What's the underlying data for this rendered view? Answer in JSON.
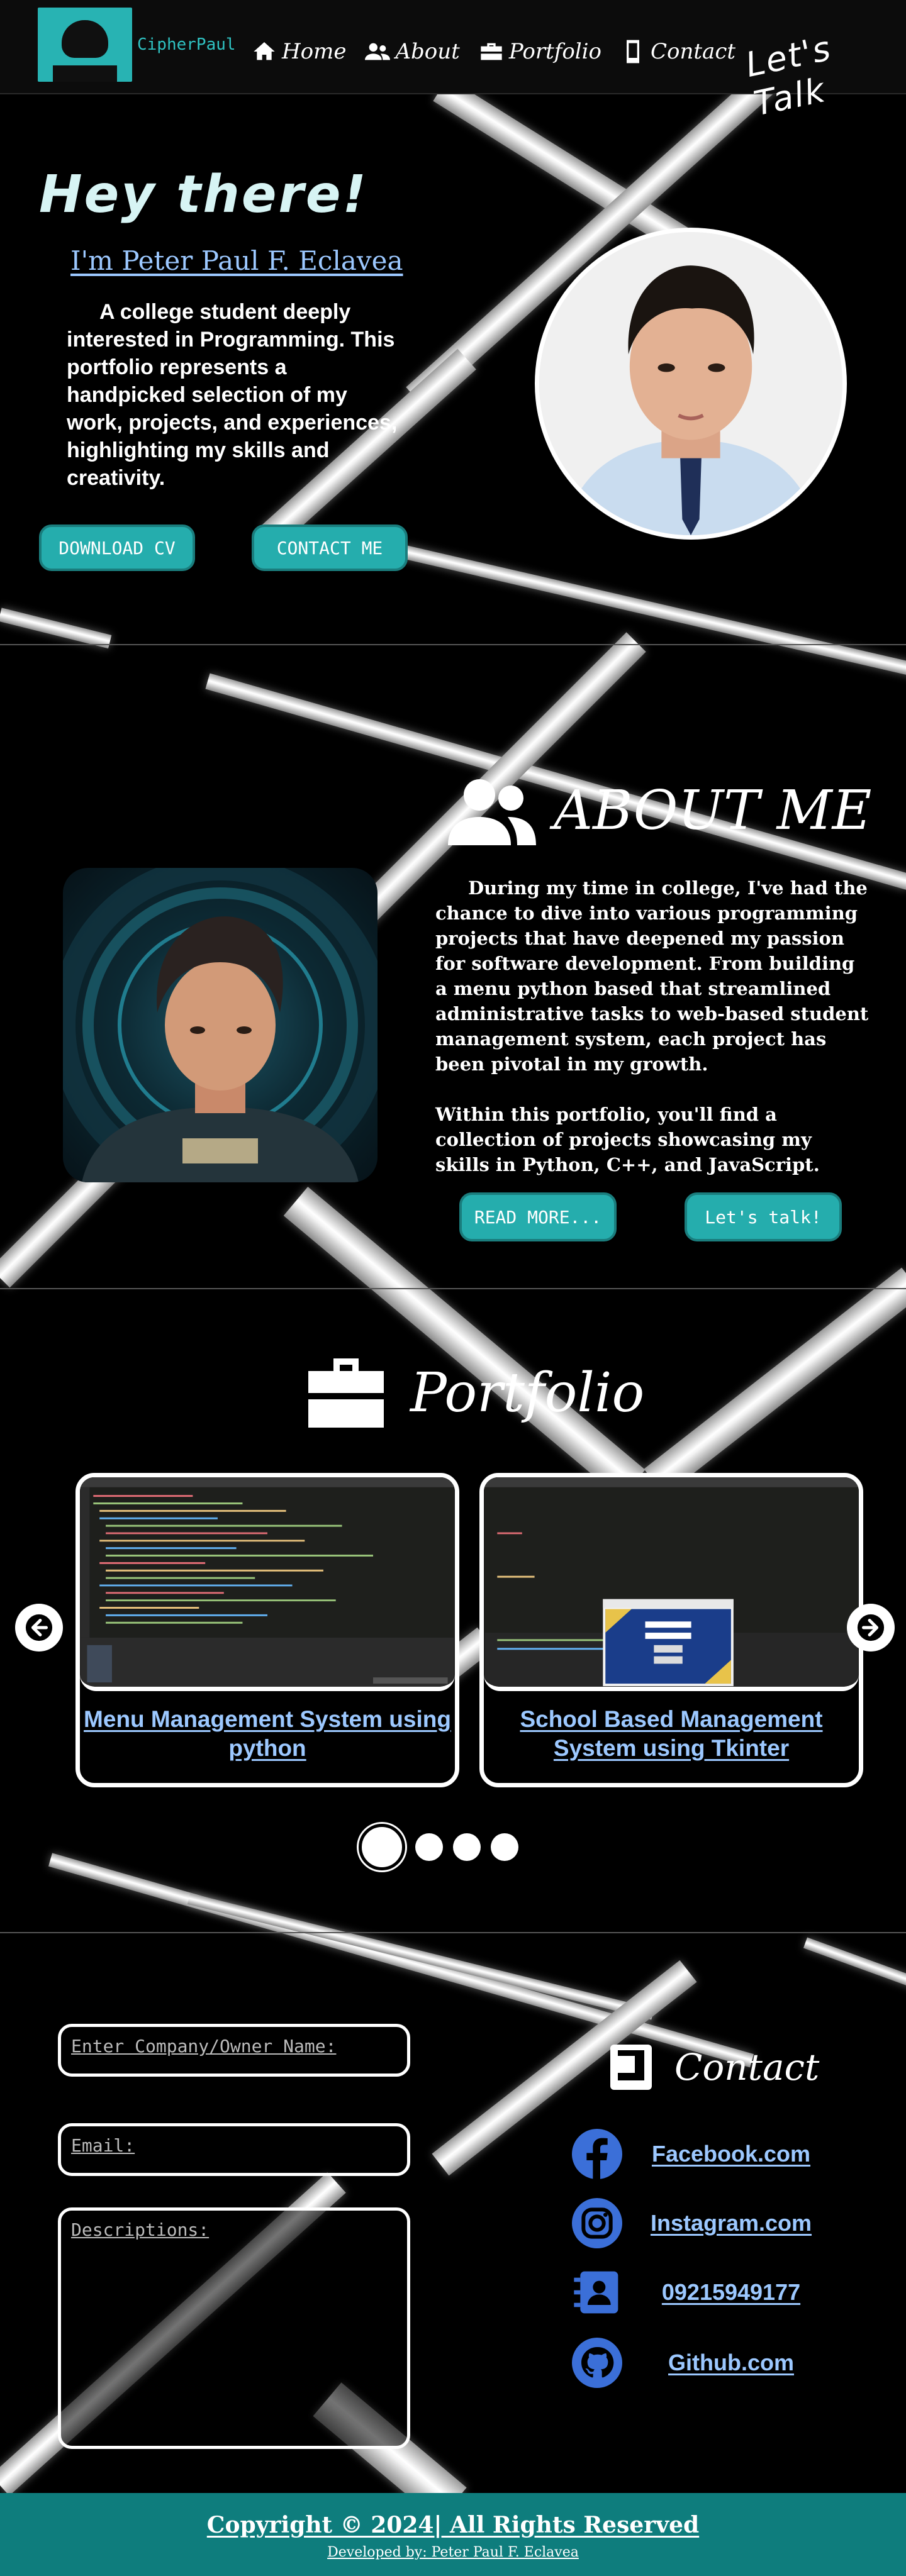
{
  "brand": {
    "name": "CipherPaul"
  },
  "nav": {
    "items": [
      {
        "label": "Home",
        "icon": "home-icon"
      },
      {
        "label": "About",
        "icon": "users-icon"
      },
      {
        "label": "Portfolio",
        "icon": "briefcase-icon"
      },
      {
        "label": "Contact",
        "icon": "phone-icon"
      }
    ],
    "cta": "Let's Talk"
  },
  "hero": {
    "greeting": "Hey there!",
    "name": "I'm Peter Paul F. Eclavea",
    "description": "A college student deeply interested in Programming. This portfolio represents a handpicked selection of my work, projects, and experiences, highlighting my skills and creativity.",
    "download_label": "DOWNLOAD CV",
    "contact_label": "CONTACT ME"
  },
  "about": {
    "title": "ABOUT ME",
    "paragraph1": "During my time in college, I've had the chance to dive into various programming projects that have deepened my passion for software development. From building a menu python based that streamlined administrative tasks to web-based student management system, each project has been pivotal in my growth.",
    "paragraph2": "Within this portfolio, you'll find a collection of projects showcasing my skills in Python, C++, and JavaScript.",
    "read_more_label": "READ MORE...",
    "lets_talk_label": "Let's talk!"
  },
  "portfolio": {
    "title": "Portfolio",
    "cards": [
      {
        "title": "Menu Management System using python"
      },
      {
        "title": "School Based Management System using Tkinter"
      }
    ],
    "dots": 4,
    "active_dot": 0
  },
  "contact": {
    "title": "Contact",
    "name_placeholder": "Enter Company/Owner Name:",
    "email_placeholder": "Email:",
    "desc_placeholder": "Descriptions:",
    "links": [
      {
        "label": "Facebook.com",
        "icon": "facebook-icon"
      },
      {
        "label": "Instagram.com",
        "icon": "instagram-icon"
      },
      {
        "label": "09215949177",
        "icon": "contact-card-icon"
      },
      {
        "label": "Github.com",
        "icon": "github-icon"
      }
    ]
  },
  "footer": {
    "copyright": "Copyright © 2024| All Rights Reserved",
    "developer": "Developed by: Peter Paul F. Eclavea"
  },
  "colors": {
    "accent": "#25adad",
    "link": "#9cc8ff",
    "footer": "#0e7d7d",
    "icon_blue": "#3b6fd8"
  }
}
